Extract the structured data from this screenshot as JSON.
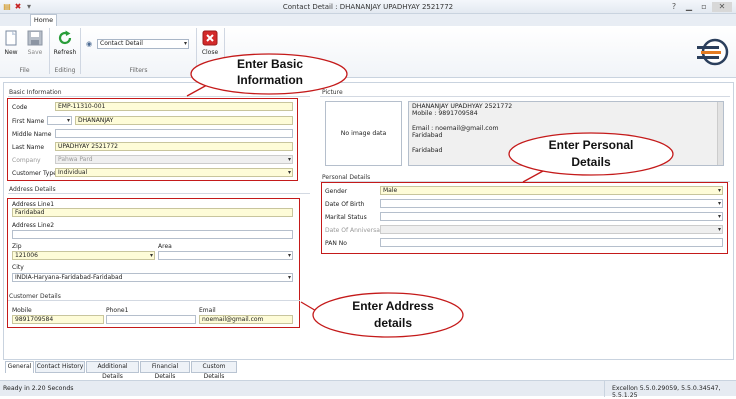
{
  "window": {
    "title": "Contact  Detail : DHANANJAY  UPADHYAY 2521772"
  },
  "ribbon": {
    "tab_home": "Home",
    "new": "New",
    "save": "Save",
    "refresh": "Refresh",
    "close": "Close",
    "filter_value": "Contact  Detail",
    "group_file": "File",
    "group_editing": "Editing",
    "group_filters": "Filters"
  },
  "basic": {
    "section": "Basic Information",
    "code_label": "Code",
    "code": "EMP-11310-001",
    "first_name_label": "First Name",
    "salutation": "",
    "first_name": "DHANANJAY",
    "middle_name_label": "Middle Name",
    "middle_name": "",
    "last_name_label": "Last Name",
    "last_name": "UPADHYAY 2521772",
    "company_label": "Company",
    "company": "Pahwa Pard",
    "customer_type_label": "Customer Type",
    "customer_type": "Individual"
  },
  "address": {
    "section": "Address Details",
    "line1_label": "Address Line1",
    "line1": "Faridabad",
    "line2_label": "Address Line2",
    "line2": "",
    "zip_label": "Zip",
    "zip": "121006",
    "area_label": "Area",
    "area": "",
    "city_label": "City",
    "city": "INDIA-Haryana-Faridabad-Faridabad"
  },
  "customer": {
    "section": "Customer Details",
    "mobile_label": "Mobile",
    "mobile": "9891709584",
    "phone_label": "Phone1",
    "phone": "",
    "email_label": "Email",
    "email": "noemail@gmail.com"
  },
  "picture": {
    "section": "Picture",
    "no_image": "No image data",
    "summary": [
      "DHANANJAY  UPADHYAY 2521772",
      "Mobile : 9891709584",
      "",
      "Email : noemail@gmail.com",
      "Faridabad",
      "",
      "Faridabad"
    ]
  },
  "personal": {
    "section": "Personal Details",
    "gender_label": "Gender",
    "gender": "Male",
    "dob_label": "Date Of Birth",
    "dob": "",
    "marital_label": "Marital Status",
    "marital": "",
    "anniv_label": "Date Of Anniversary",
    "anniv": "",
    "pan_label": "PAN No",
    "pan": ""
  },
  "callouts": {
    "basic": [
      "Enter Basic",
      "Information"
    ],
    "personal": [
      "Enter Personal",
      "Details"
    ],
    "address": [
      "Enter Address",
      "details"
    ]
  },
  "tabs": [
    "General",
    "Contact History",
    "Additional Details",
    "Financial Details",
    "Custom Details"
  ],
  "status": {
    "left": "Ready in 2.20 Seconds",
    "right": "Excellon 5.5.0.29059, 5.5.0.34547, 5.5.1.25"
  }
}
